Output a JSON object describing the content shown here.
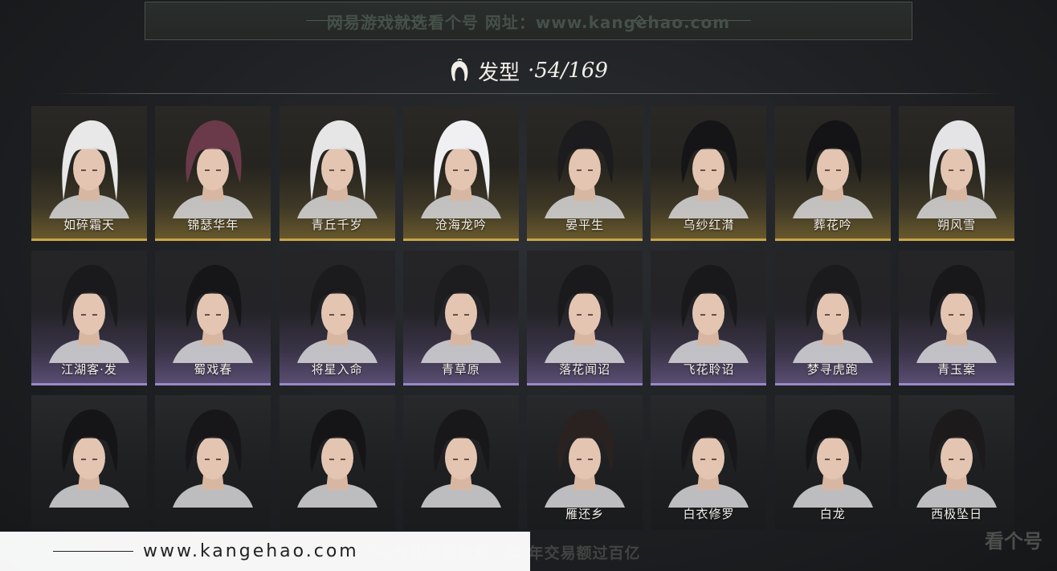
{
  "top_watermark": "网易游戏就选看个号  网址：www.kangehao.com",
  "heading": {
    "title": "发型",
    "separator": "·",
    "count": "54/169"
  },
  "rows": [
    {
      "tier": "gold",
      "items": [
        "如碎霜天",
        "锦瑟华年",
        "青丘千岁",
        "沧海龙吟",
        "晏平生",
        "乌纱红潸",
        "葬花吟",
        "朔风雪"
      ]
    },
    {
      "tier": "purple",
      "items": [
        "江湖客·发",
        "蜀戏春",
        "将星入命",
        "青草原",
        "落花闻诏",
        "飞花聆诏",
        "梦寻虎跑",
        "青玉案"
      ]
    },
    {
      "tier": "plain",
      "items": [
        "",
        "",
        "",
        "",
        "雁还乡",
        "白衣修罗",
        "白龙",
        "西极坠日"
      ]
    }
  ],
  "hair_colors": [
    "#e8e8e8",
    "#6a3a4a",
    "#e6e6e6",
    "#f0f0f2",
    "#1c1c1e",
    "#151517",
    "#141416",
    "#e4e4e6",
    "#1a1a1c",
    "#161618",
    "#1b1b1d",
    "#1d1d1f",
    "#1a1a1c",
    "#19191b",
    "#1b1b1d",
    "#18181a",
    "#151517",
    "#171719",
    "#151517",
    "#18181a",
    "#2a2220",
    "#18181a",
    "#151517",
    "#1c1a1a"
  ],
  "bottom_url": "www.kangehao.com",
  "bottom_watermark": "看个号专业网易游戏八年  年交易额过百亿",
  "logo_text": "看个号"
}
